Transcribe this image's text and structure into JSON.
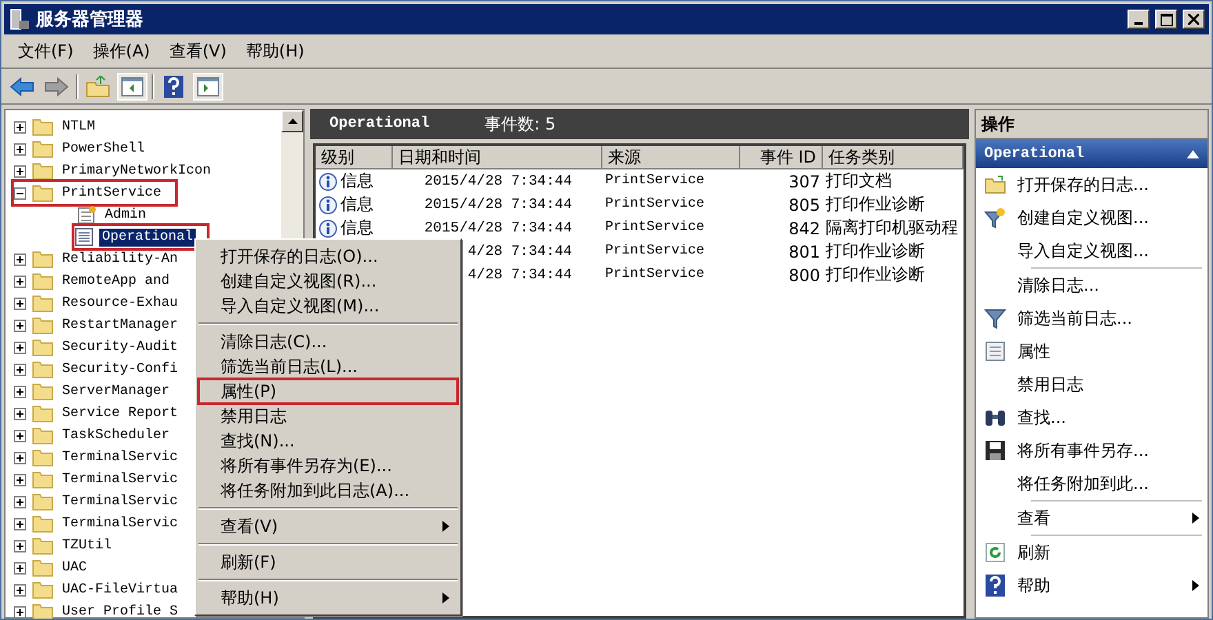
{
  "window": {
    "title": "服务器管理器"
  },
  "menu_bar": [
    "文件(F)",
    "操作(A)",
    "查看(V)",
    "帮助(H)"
  ],
  "tree": {
    "items": [
      {
        "label": "NTLM",
        "expanded": false,
        "annotated": false
      },
      {
        "label": "PowerShell",
        "expanded": false,
        "annotated": false
      },
      {
        "label": "PrimaryNetworkIcon",
        "expanded": false,
        "annotated": false
      },
      {
        "label": "PrintService",
        "expanded": true,
        "annotated": true,
        "children": [
          {
            "label": "Admin",
            "kind": "admin",
            "selected": false,
            "annotated": false
          },
          {
            "label": "Operational",
            "kind": "log",
            "selected": true,
            "annotated": true
          }
        ]
      },
      {
        "label": "Reliability-An",
        "expanded": false,
        "annotated": false
      },
      {
        "label": "RemoteApp and",
        "expanded": false,
        "annotated": false
      },
      {
        "label": "Resource-Exhau",
        "expanded": false,
        "annotated": false
      },
      {
        "label": "RestartManager",
        "expanded": false,
        "annotated": false
      },
      {
        "label": "Security-Audit",
        "expanded": false,
        "annotated": false
      },
      {
        "label": "Security-Confi",
        "expanded": false,
        "annotated": false
      },
      {
        "label": "ServerManager",
        "expanded": false,
        "annotated": false
      },
      {
        "label": "Service Report",
        "expanded": false,
        "annotated": false
      },
      {
        "label": "TaskScheduler",
        "expanded": false,
        "annotated": false
      },
      {
        "label": "TerminalServic",
        "expanded": false,
        "annotated": false
      },
      {
        "label": "TerminalServic",
        "expanded": false,
        "annotated": false
      },
      {
        "label": "TerminalServic",
        "expanded": false,
        "annotated": false
      },
      {
        "label": "TerminalServic",
        "expanded": false,
        "annotated": false
      },
      {
        "label": "TZUtil",
        "expanded": false,
        "annotated": false
      },
      {
        "label": "UAC",
        "expanded": false,
        "annotated": false
      },
      {
        "label": "UAC-FileVirtua",
        "expanded": false,
        "annotated": false
      },
      {
        "label": "User Profile S",
        "expanded": false,
        "annotated": false
      }
    ]
  },
  "log_header": {
    "title": "Operational",
    "count": "事件数: 5"
  },
  "table": {
    "columns": [
      "级别",
      "日期和时间",
      "来源",
      "事件 ID",
      "任务类别"
    ],
    "rows": [
      {
        "level": "信息",
        "date": "2015/4/28 7:34:44",
        "source": "PrintService",
        "event_id": "307",
        "task": "打印文档"
      },
      {
        "level": "信息",
        "date": "2015/4/28 7:34:44",
        "source": "PrintService",
        "event_id": "805",
        "task": "打印作业诊断"
      },
      {
        "level": "信息",
        "date": "2015/4/28 7:34:44",
        "source": "PrintService",
        "event_id": "842",
        "task": "隔离打印机驱动程"
      },
      {
        "date": "4/28 7:34:44",
        "source": "PrintService",
        "event_id": "801",
        "task": "打印作业诊断"
      },
      {
        "date": "4/28 7:34:44",
        "source": "PrintService",
        "event_id": "800",
        "task": "打印作业诊断"
      }
    ]
  },
  "context_menu": [
    {
      "kind": "item",
      "label": "打开保存的日志(O)...",
      "annotated": false
    },
    {
      "kind": "item",
      "label": "创建自定义视图(R)...",
      "annotated": false
    },
    {
      "kind": "item",
      "label": "导入自定义视图(M)...",
      "annotated": false
    },
    {
      "kind": "separator"
    },
    {
      "kind": "item",
      "label": "清除日志(C)...",
      "annotated": false
    },
    {
      "kind": "item",
      "label": "筛选当前日志(L)...",
      "annotated": false
    },
    {
      "kind": "item",
      "label": "属性(P)",
      "annotated": true
    },
    {
      "kind": "item",
      "label": "禁用日志",
      "annotated": false
    },
    {
      "kind": "item",
      "label": "查找(N)...",
      "annotated": false
    },
    {
      "kind": "item",
      "label": "将所有事件另存为(E)...",
      "annotated": false
    },
    {
      "kind": "item",
      "label": "将任务附加到此日志(A)...",
      "annotated": false
    },
    {
      "kind": "separator"
    },
    {
      "kind": "submenu",
      "label": "查看(V)",
      "annotated": false
    },
    {
      "kind": "separator"
    },
    {
      "kind": "item",
      "label": "刷新(F)",
      "annotated": false
    },
    {
      "kind": "separator"
    },
    {
      "kind": "submenu",
      "label": "帮助(H)",
      "annotated": false
    }
  ],
  "actions": {
    "title": "操作",
    "section": "Operational",
    "expanded": true,
    "items": [
      {
        "kind": "item",
        "label": "打开保存的日志..."
      },
      {
        "kind": "item",
        "label": "创建自定义视图..."
      },
      {
        "kind": "item",
        "label": "导入自定义视图..."
      },
      {
        "kind": "separator"
      },
      {
        "kind": "item",
        "label": "清除日志..."
      },
      {
        "kind": "item",
        "label": "筛选当前日志..."
      },
      {
        "kind": "item",
        "label": "属性"
      },
      {
        "kind": "item",
        "label": "禁用日志"
      },
      {
        "kind": "item",
        "label": "查找..."
      },
      {
        "kind": "item",
        "label": "将所有事件另存..."
      },
      {
        "kind": "item",
        "label": "将任务附加到此..."
      },
      {
        "kind": "separator"
      },
      {
        "kind": "submenu",
        "label": "查看"
      },
      {
        "kind": "separator"
      },
      {
        "kind": "item",
        "label": "刷新"
      },
      {
        "kind": "submenu",
        "label": "帮助"
      }
    ]
  }
}
